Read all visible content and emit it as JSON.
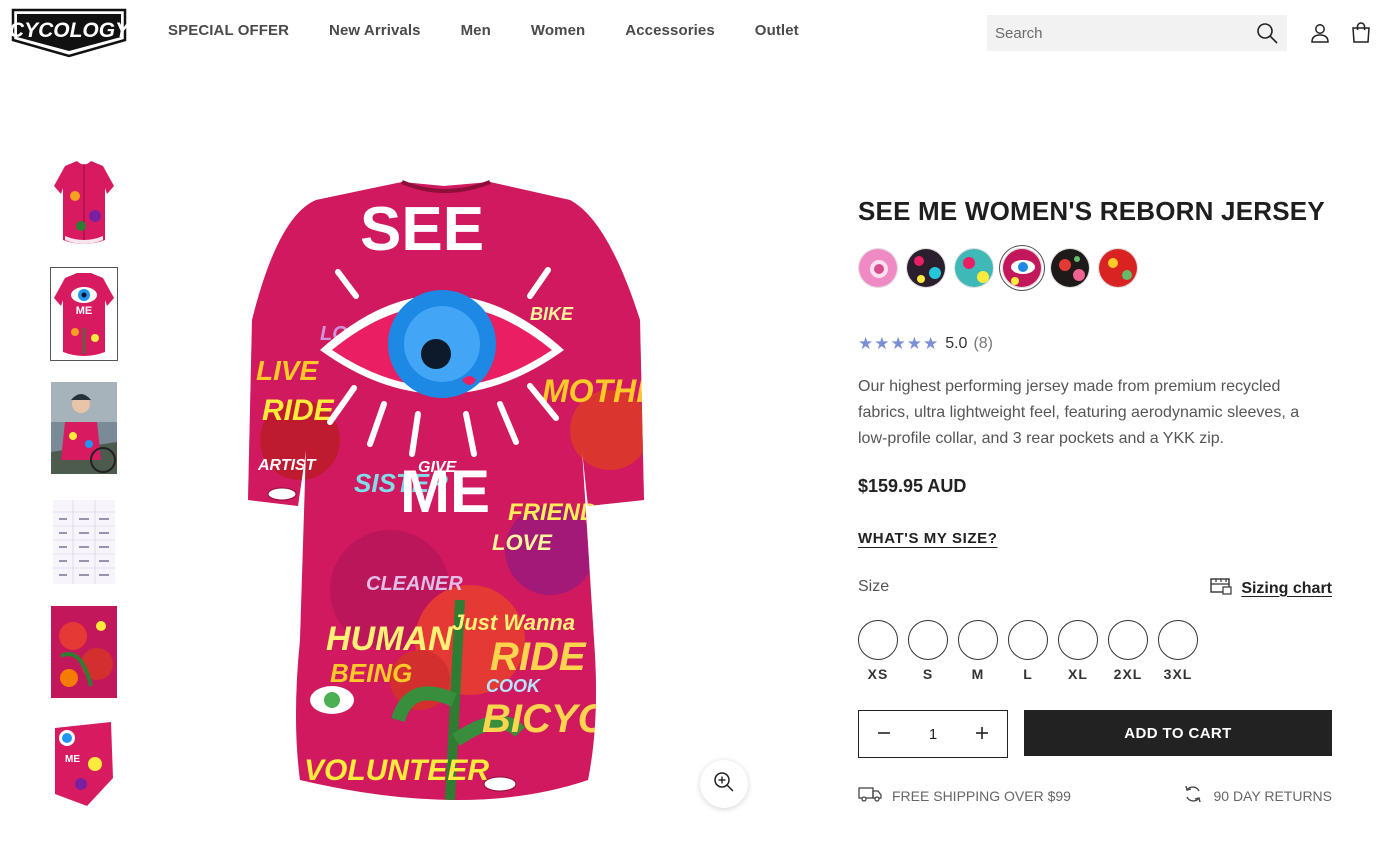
{
  "header": {
    "logo_text": "CYCOLOGY",
    "nav": [
      "SPECIAL OFFER",
      "New Arrivals",
      "Men",
      "Women",
      "Accessories",
      "Outlet"
    ],
    "search_placeholder": "Search"
  },
  "product": {
    "title": "SEE ME WOMEN'S REBORN JERSEY",
    "swatches": [
      {
        "name": "pink",
        "color": "#f08ac4"
      },
      {
        "name": "black-floral",
        "color": "#2b1f2e"
      },
      {
        "name": "teal",
        "color": "#3fb8b8"
      },
      {
        "name": "see-me",
        "color": "#c2185b"
      },
      {
        "name": "black-roses",
        "color": "#1e1a1a"
      },
      {
        "name": "red",
        "color": "#d92323"
      }
    ],
    "selected_swatch": "see-me",
    "rating": "5.0",
    "rating_count": "(8)",
    "stars": "★★★★★",
    "description": "Our highest performing jersey made from premium recycled fabrics, ultra lightweight feel, featuring aerodynamic sleeves, a low-profile collar, and 3 rear pockets and a YKK zip.",
    "price": "$159.95 AUD",
    "size_help_link": "WHAT'S MY SIZE?",
    "size_label": "Size",
    "sizing_chart_label": "Sizing chart",
    "sizes": [
      "XS",
      "S",
      "M",
      "L",
      "XL",
      "2XL",
      "3XL"
    ],
    "quantity": "1",
    "add_to_cart": "ADD TO CART",
    "perk_shipping": "FREE SHIPPING OVER $99",
    "perk_returns": "90 DAY RETURNS"
  },
  "jersey_text": {
    "see": "SEE",
    "me": "ME",
    "scribbles": [
      "LIVE",
      "RIDE",
      "LOVER",
      "BIKE",
      "ARTIST",
      "SISTER",
      "FRIEND",
      "HUMAN",
      "BEING",
      "RIDE",
      "BICYCLE",
      "COOK",
      "VOLUNTEER",
      "MOTHER",
      "LOVE",
      "Just Wanna",
      "GIVE",
      "CLEANER"
    ]
  },
  "colors": {
    "accent": "#222222",
    "star": "#7b8fd6",
    "jersey_base": "#d91a5a"
  }
}
